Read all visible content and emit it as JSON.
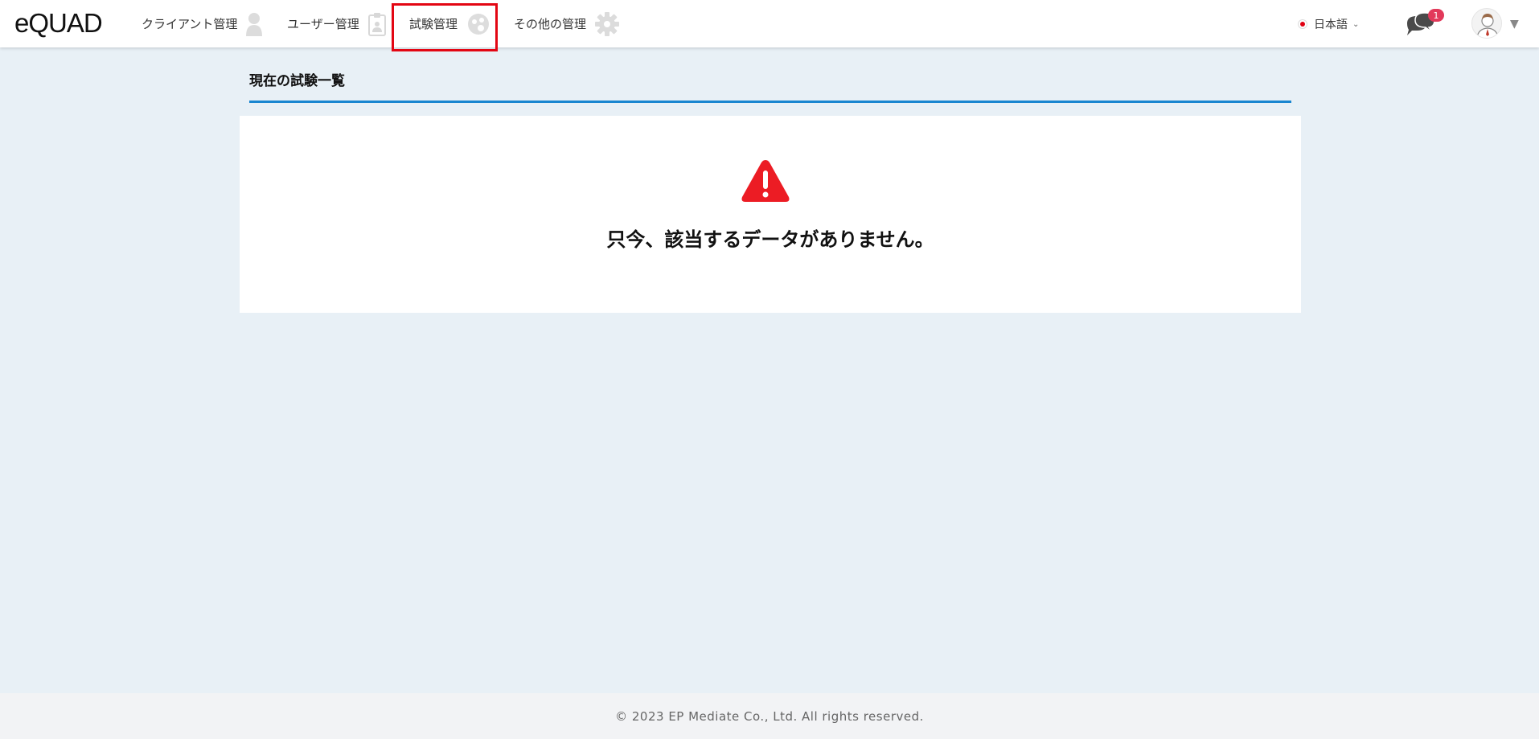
{
  "brand": {
    "logo_text": "eQUAD"
  },
  "nav": {
    "items": [
      {
        "label": "クライアント管理",
        "icon": "person-icon"
      },
      {
        "label": "ユーザー管理",
        "icon": "id-badge-icon"
      },
      {
        "label": "試験管理",
        "icon": "exam-icon",
        "active": true
      },
      {
        "label": "その他の管理",
        "icon": "gear-icon"
      }
    ]
  },
  "header": {
    "language": "日本語",
    "notification_count": "1"
  },
  "page": {
    "title": "現在の試験一覧",
    "empty_message": "只今、該当するデータがありません。"
  },
  "footer": {
    "copyright": "© 2023 EP Mediate Co., Ltd. All rights reserved."
  },
  "colors": {
    "accent_blue": "#1a86d0",
    "active_outline": "#e30613",
    "warning": "#e8101a",
    "badge": "#e2395a",
    "background": "#e8f0f6"
  }
}
